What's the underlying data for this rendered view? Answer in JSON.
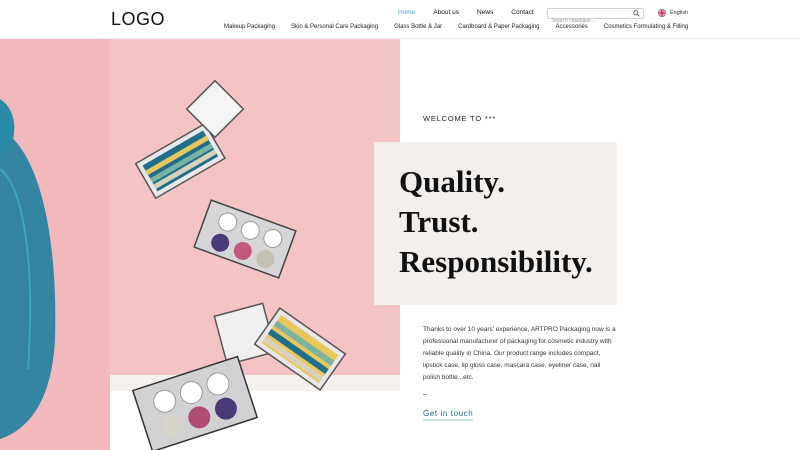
{
  "header": {
    "logo": "LOGO",
    "top_nav": [
      "Home",
      "About us",
      "News",
      "Contact"
    ],
    "active_nav": "Home",
    "search_placeholder": "Search catalogue...",
    "language": "English",
    "categories": [
      "Makeup Packaging",
      "Skin & Personal Care Packaging",
      "Glass Bottle & Jar",
      "Cardboard & Paper Packaging",
      "Accessories",
      "Cosmetics Formulating & Filling"
    ]
  },
  "hero": {
    "welcome": "WELCOME TO ***",
    "headline": [
      "Quality.",
      "Trust.",
      "Responsibility."
    ],
    "description": "Thanks to over 10 years' experience, ARTPRO Packaging now is a professional manufacturer of packaging for cosmetic industry with reliable quality in China. Our product range includes compact, lipstick case, lip gloss case, mascara case, eyeliner case, nail polish bottle...etc.",
    "dash": "–",
    "cta": "Get in touch"
  },
  "colors": {
    "accent": "#4aa8c7",
    "hero_pink": "#f4c3c6",
    "box_bg": "#f2efed",
    "cta_underline": "#c6e8df"
  },
  "icons": [
    "search-icon",
    "flag-icon"
  ]
}
